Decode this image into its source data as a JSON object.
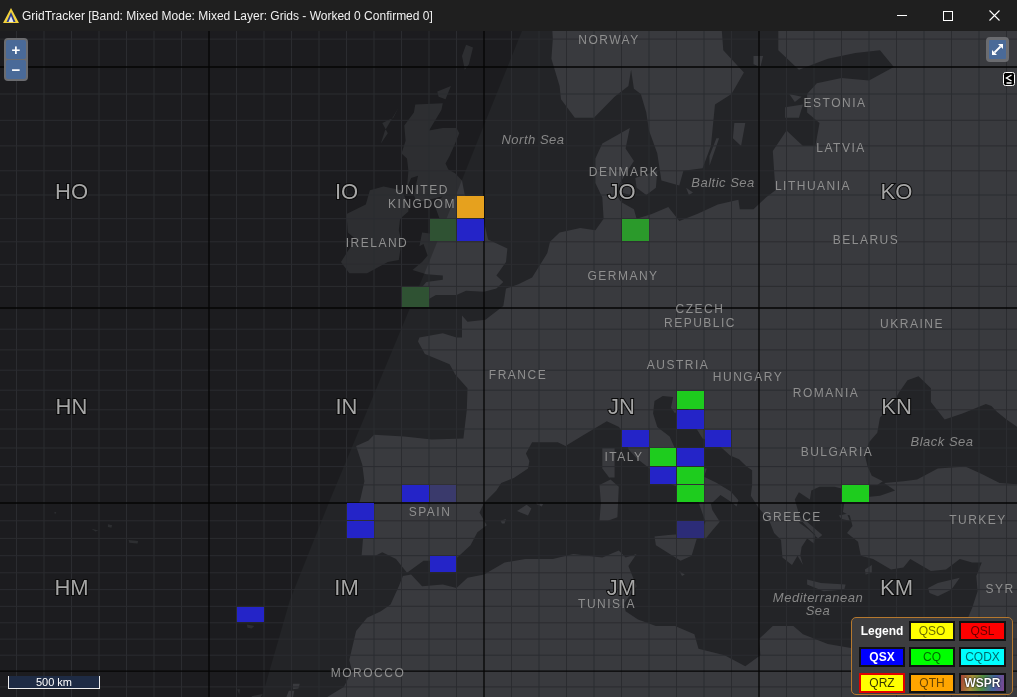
{
  "window": {
    "title": "GridTracker [Band: Mixed Mode: Mixed Layer: Grids - Worked 0 Confirmed 0]"
  },
  "map": {
    "zoom_buttons": [
      "+",
      "−"
    ],
    "grid_fields": [
      "HO",
      "IO",
      "JO",
      "KO",
      "HN",
      "IN",
      "JN",
      "KN",
      "HM",
      "IM",
      "JM",
      "KM"
    ],
    "places": [
      {
        "text": "NORWAY",
        "kind": "country"
      },
      {
        "text": "ESTONIA",
        "kind": "country"
      },
      {
        "text": "North Sea",
        "kind": "sea"
      },
      {
        "text": "LATVIA",
        "kind": "country"
      },
      {
        "text": "DENMARK",
        "kind": "country"
      },
      {
        "text": "Baltic Sea",
        "kind": "sea"
      },
      {
        "text": "LITHUANIA",
        "kind": "country"
      },
      {
        "text": "UNITED KINGDOM",
        "kind": "country"
      },
      {
        "text": "IRELAND",
        "kind": "country"
      },
      {
        "text": "BELARUS",
        "kind": "country"
      },
      {
        "text": "GERMANY",
        "kind": "country"
      },
      {
        "text": "CZECH REPUBLIC",
        "kind": "country"
      },
      {
        "text": "UKRAINE",
        "kind": "country"
      },
      {
        "text": "AUSTRIA",
        "kind": "country"
      },
      {
        "text": "FRANCE",
        "kind": "country"
      },
      {
        "text": "HUNGARY",
        "kind": "country"
      },
      {
        "text": "ROMANIA",
        "kind": "country"
      },
      {
        "text": "Black Sea",
        "kind": "sea"
      },
      {
        "text": "BULGARIA",
        "kind": "country"
      },
      {
        "text": "ITALY",
        "kind": "country"
      },
      {
        "text": "SPAIN",
        "kind": "country"
      },
      {
        "text": "GREECE",
        "kind": "country"
      },
      {
        "text": "TURKEY",
        "kind": "country"
      },
      {
        "text": "SYR",
        "kind": "country"
      },
      {
        "text": "TUNISIA",
        "kind": "country"
      },
      {
        "text": "Mediterranean Sea",
        "kind": "sea"
      },
      {
        "text": "MOROCCO",
        "kind": "country"
      }
    ],
    "grid_squares": [
      {
        "color": "#e6a11e"
      },
      {
        "color": "#2f5233"
      },
      {
        "color": "#2424c8"
      },
      {
        "color": "#2b9a2b"
      },
      {
        "color": "#2f5233"
      },
      {
        "color": "#1ecc1e"
      },
      {
        "color": "#2424c8"
      },
      {
        "color": "#2424c8"
      },
      {
        "color": "#2424c8"
      },
      {
        "color": "#1ecc1e"
      },
      {
        "color": "#2424c8"
      },
      {
        "color": "#2424c8"
      },
      {
        "color": "#1ecc1e"
      },
      {
        "color": "#2424c8"
      },
      {
        "color": "#3a3a6c"
      },
      {
        "color": "#1ecc1e"
      },
      {
        "color": "#1ecc1e"
      },
      {
        "color": "#2424c8"
      },
      {
        "color": "#2424c8"
      },
      {
        "color": "#2c2c78"
      },
      {
        "color": "#2424c8"
      },
      {
        "color": "#2424c8"
      }
    ],
    "scale": "500 km"
  },
  "legend": {
    "title": "Legend",
    "items": [
      {
        "label": "QSO",
        "color": "#ffff00",
        "kind": "solid"
      },
      {
        "label": "QSL",
        "color": "#ff0000",
        "kind": "solid"
      },
      {
        "label": "QSX",
        "color": "#0000ff",
        "kind": "solid"
      },
      {
        "label": "CQ",
        "color": "#00ff00",
        "kind": "solid"
      },
      {
        "label": "CQDX",
        "color": "#00ffff",
        "kind": "solid"
      },
      {
        "label": "QRZ",
        "color": "#ffff00",
        "kind": "outlined"
      },
      {
        "label": "QTH",
        "color": "#ffa500",
        "kind": "solid"
      },
      {
        "label": "WSPR",
        "kind": "rainbow"
      }
    ]
  }
}
